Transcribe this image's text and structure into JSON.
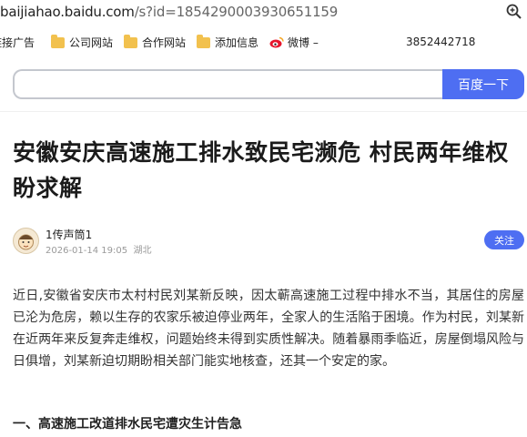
{
  "address_bar": {
    "host": "baijiahao.baidu.com",
    "path": "/s?id=1854290003930651159"
  },
  "bookmarks": {
    "items": [
      {
        "label": "链接广告"
      },
      {
        "label": "公司网站"
      },
      {
        "label": "合作网站"
      },
      {
        "label": "添加信息"
      },
      {
        "label": "微博 –"
      }
    ],
    "number": "3852442718"
  },
  "search": {
    "placeholder": "",
    "button_label": "百度一下"
  },
  "article": {
    "title": "安徽安庆高速施工排水致民宅濒危 村民两年维权盼求解",
    "author_name": "1传声筒1",
    "date": "2026-01-14 19:05",
    "location": "湖北",
    "follow_label": "关注",
    "paragraph": "近日,安徽省安庆市太村村民刘某新反映，因太蕲高速施工过程中排水不当，其居住的房屋已沦为危房，赖以生存的农家乐被迫停业两年，全家人的生活陷于困境。作为村民，刘某新在近两年来反复奔走维权，问题始终未得到实质性解决。随着暴雨季临近，房屋倒塌风险与日俱增，刘某新迫切期盼相关部门能实地核查，还其一个安定的家。",
    "section_heading": "一、高速施工改道排水民宅遭灾生计告急"
  },
  "colors": {
    "accent": "#4e6ef2",
    "folder": "#f2c14e"
  }
}
